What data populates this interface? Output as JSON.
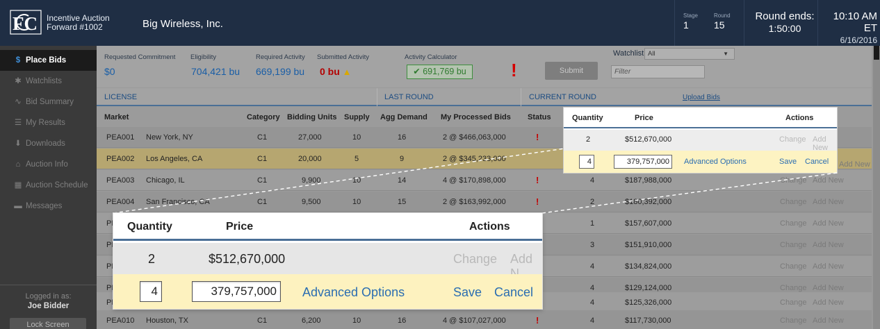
{
  "header": {
    "auction_line1": "Incentive Auction",
    "auction_line2": "Forward #1002",
    "bidder": "Big Wireless, Inc.",
    "stage_label": "Stage",
    "stage_value": "1",
    "round_label": "Round",
    "round_value": "15",
    "round_ends_label": "Round ends:",
    "round_ends_value": "1:50:00",
    "clock_time": "10:10 AM ET",
    "clock_date": "6/16/2016"
  },
  "sidebar": {
    "items": [
      {
        "label": "Place Bids",
        "icon": "dollar-icon",
        "glyph": "$"
      },
      {
        "label": "Watchlists",
        "icon": "asterisk-icon",
        "glyph": "✱"
      },
      {
        "label": "Bid Summary",
        "icon": "pulse-icon",
        "glyph": "∿"
      },
      {
        "label": "My Results",
        "icon": "document-icon",
        "glyph": "☰"
      },
      {
        "label": "Downloads",
        "icon": "download-icon",
        "glyph": "⬇"
      },
      {
        "label": "Auction Info",
        "icon": "home-icon",
        "glyph": "⌂"
      },
      {
        "label": "Auction Schedule",
        "icon": "calendar-icon",
        "glyph": "▦"
      },
      {
        "label": "Messages",
        "icon": "chat-icon",
        "glyph": "▬"
      }
    ],
    "logged_in_label": "Logged in as:",
    "user": "Joe Bidder",
    "lock_label": "Lock Screen"
  },
  "summary": {
    "requested_commitment_label": "Requested Commitment",
    "requested_commitment": "$0",
    "eligibility_label": "Eligibility",
    "eligibility": "704,421 bu",
    "required_activity_label": "Required Activity",
    "required_activity": "669,199 bu",
    "submitted_activity_label": "Submitted Activity",
    "submitted_activity": "0 bu",
    "activity_calculator_label": "Activity Calculator",
    "activity_calculator": "691,769 bu",
    "submit_label": "Submit",
    "watchlist_label": "Watchlist:",
    "watchlist_value": "All",
    "filter_placeholder": "Filter"
  },
  "groups": {
    "license": "LICENSE",
    "last_round": "LAST ROUND",
    "current_round": "CURRENT ROUND",
    "upload_bids": "Upload Bids"
  },
  "columns": {
    "market": "Market",
    "category": "Category",
    "bidding_units": "Bidding Units",
    "supply": "Supply",
    "agg_demand": "Agg Demand",
    "processed_bids": "My Processed Bids",
    "status": "Status",
    "quantity": "Quantity",
    "price": "Price",
    "actions": "Actions"
  },
  "rows": [
    {
      "id": "PEA001",
      "market": "New York, NY",
      "cat": "C1",
      "units": "27,000",
      "supply": "10",
      "agg": "16",
      "bids": "2 @ $466,063,000",
      "status": "!",
      "qty": "2",
      "price": "$512,670,000"
    },
    {
      "id": "PEA002",
      "market": "Los Angeles, CA",
      "cat": "C1",
      "units": "20,000",
      "supply": "5",
      "agg": "9",
      "bids": "2 @ $345,233,000",
      "status": "",
      "qty": "4",
      "price": "379,757,000"
    },
    {
      "id": "PEA003",
      "market": "Chicago, IL",
      "cat": "C1",
      "units": "9,900",
      "supply": "10",
      "agg": "14",
      "bids": "4 @ $170,898,000",
      "status": "!",
      "qty": "4",
      "price": "$187,988,000"
    },
    {
      "id": "PEA004",
      "market": "San Francisco, CA",
      "cat": "C1",
      "units": "9,500",
      "supply": "10",
      "agg": "15",
      "bids": "2 @ $163,992,000",
      "status": "!",
      "qty": "2",
      "price": "$180,392,000"
    },
    {
      "id": "PE",
      "market": "",
      "cat": "",
      "units": "",
      "supply": "",
      "agg": "",
      "bids": "",
      "status": "",
      "qty": "1",
      "price": "$157,607,000"
    },
    {
      "id": "PE",
      "market": "",
      "cat": "",
      "units": "",
      "supply": "",
      "agg": "",
      "bids": "",
      "status": "",
      "qty": "3",
      "price": "$151,910,000"
    },
    {
      "id": "PE",
      "market": "",
      "cat": "",
      "units": "",
      "supply": "",
      "agg": "",
      "bids": "",
      "status": "",
      "qty": "4",
      "price": "$134,824,000"
    },
    {
      "id": "PE",
      "market": "",
      "cat": "",
      "units": "",
      "supply": "",
      "agg": "",
      "bids": "",
      "status": "",
      "qty": "4",
      "price": "$129,124,000"
    },
    {
      "id": "PE",
      "market": "",
      "cat": "",
      "units": "",
      "supply": "",
      "agg": "",
      "bids": "",
      "status": "",
      "qty": "4",
      "price": "$125,326,000"
    },
    {
      "id": "PEA010",
      "market": "Houston, TX",
      "cat": "C1",
      "units": "6,200",
      "supply": "10",
      "agg": "16",
      "bids": "4 @ $107,027,000",
      "status": "!",
      "qty": "4",
      "price": "$117,730,000"
    }
  ],
  "actions": {
    "change": "Change",
    "add_new": "Add New",
    "advanced": "Advanced Options",
    "save": "Save",
    "cancel": "Cancel"
  },
  "zoom": {
    "quantity": "Quantity",
    "price": "Price",
    "actions": "Actions",
    "row1_qty": "2",
    "row1_price": "$512,670,000",
    "row1_change": "Change",
    "row1_add": "Add N",
    "row2_qty": "4",
    "row2_price": "379,757,000",
    "row2_adv": "Advanced Options",
    "row2_save": "Save",
    "row2_cancel": "Cancel"
  },
  "colors": {
    "topbar": "#1f2e44",
    "accent_blue": "#2a6db1",
    "alert_red": "#d60000",
    "highlight_yellow": "#fdf3c2"
  }
}
